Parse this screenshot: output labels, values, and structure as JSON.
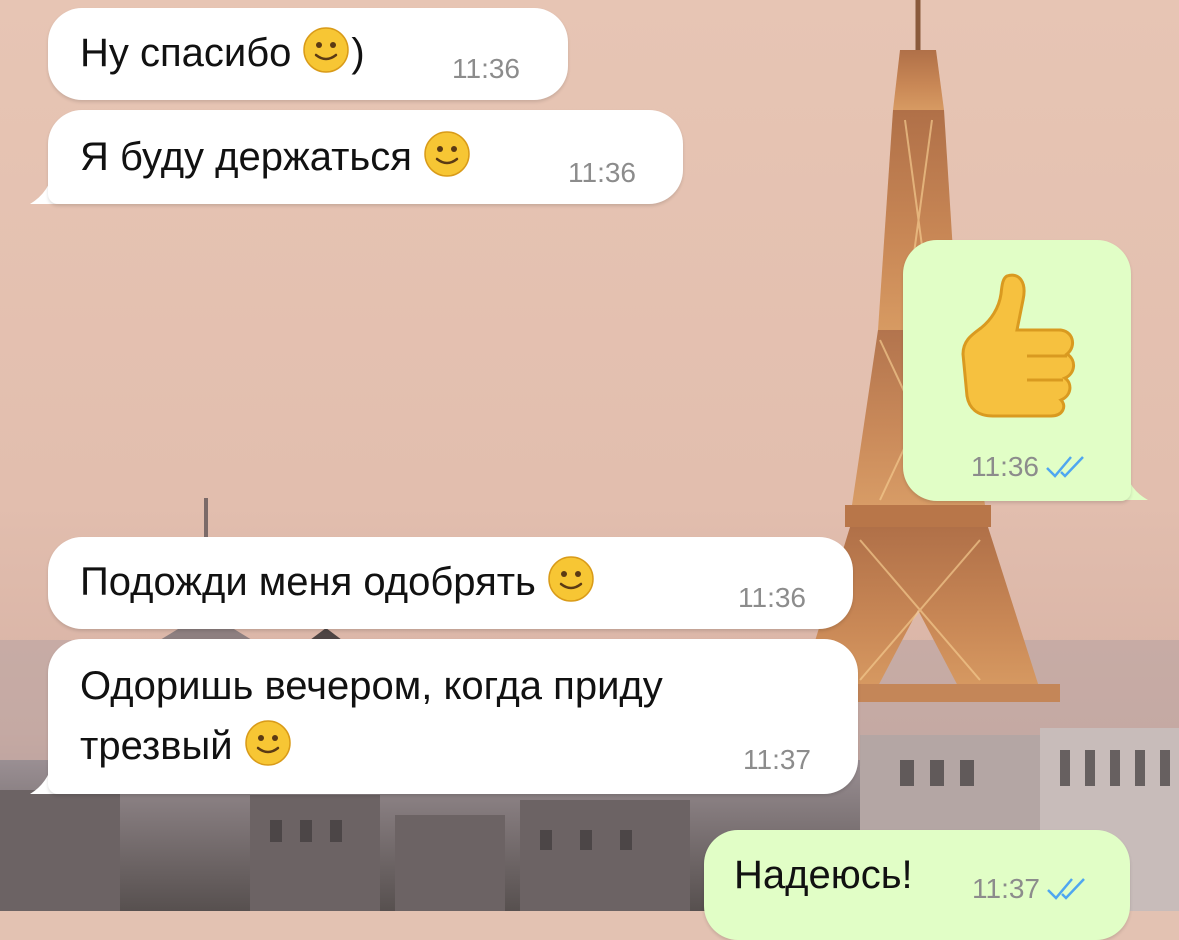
{
  "chat": {
    "messages": [
      {
        "text": "Ну спасибо",
        "suffix": ")",
        "emoji": "slightly-smiling-face",
        "time": "11:36",
        "direction": "incoming"
      },
      {
        "text": "Я буду держаться",
        "emoji": "slightly-smiling-face",
        "time": "11:36",
        "direction": "incoming"
      },
      {
        "text": "",
        "emoji": "thumbs-up",
        "time": "11:36",
        "direction": "outgoing",
        "status": "read"
      },
      {
        "text": "Подожди меня одобрять",
        "emoji": "slightly-smiling-face",
        "time": "11:36",
        "direction": "incoming"
      },
      {
        "line1": "Одоришь вечером, когда приду",
        "line2": "трезвый",
        "emoji": "slightly-smiling-face",
        "time": "11:37",
        "direction": "incoming"
      },
      {
        "text": "Надеюсь!",
        "time": "11:37",
        "direction": "outgoing",
        "status": "read"
      }
    ]
  },
  "colors": {
    "incoming_bubble": "#ffffff",
    "outgoing_bubble": "#e1fec6",
    "read_ticks": "#4fa6f0",
    "timestamp": "#8c8c8c"
  }
}
